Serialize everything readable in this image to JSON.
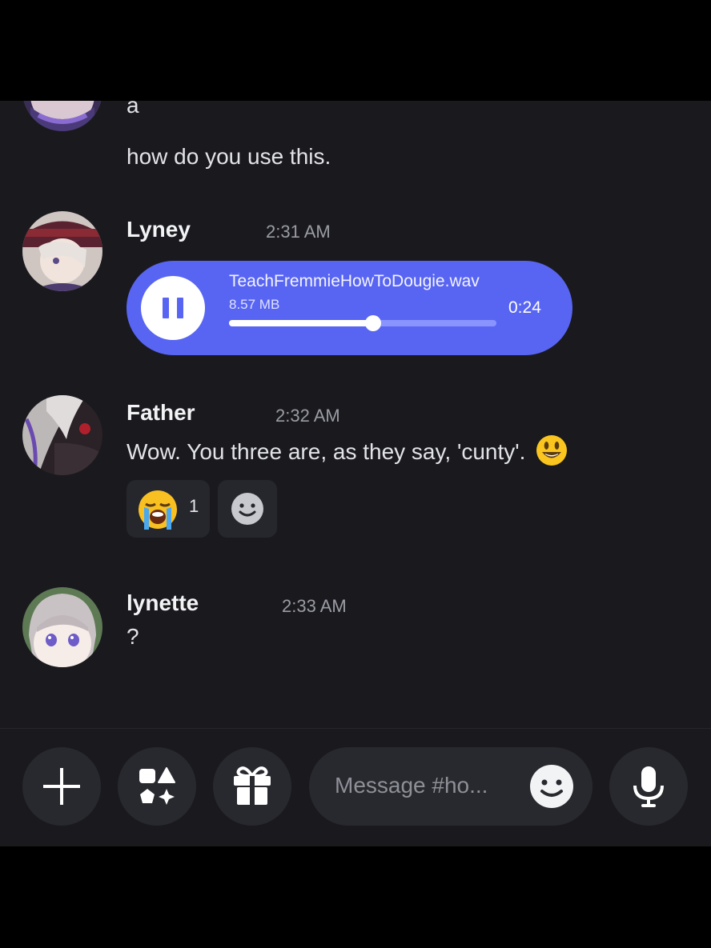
{
  "messages": [
    {
      "text": "a"
    },
    {
      "text": "how do you use this."
    }
  ],
  "lyney": {
    "username": "Lyney",
    "time": "2:31 AM",
    "attachment": {
      "filename": "TeachFremmieHowToDougie.wav",
      "size": "8.57 MB",
      "duration": "0:24",
      "progress": 0.54,
      "state": "playing"
    }
  },
  "father": {
    "username": "Father",
    "time": "2:32 AM",
    "text": "Wow. You three are, as they say, 'cunty'.",
    "text_emoji": "smiley-face-emoji",
    "reactions": [
      {
        "emoji": "loudly-crying-face",
        "count": "1"
      },
      {
        "emoji": "add-reaction-icon"
      }
    ]
  },
  "lynette": {
    "username": "lynette",
    "time": "2:33 AM",
    "text": "?"
  },
  "composer": {
    "placeholder": "Message #ho...",
    "buttons": [
      "plus-icon",
      "apps-icon",
      "gift-icon",
      "emoji-icon",
      "microphone-icon"
    ]
  },
  "colors": {
    "background": "#1a1a1e",
    "accent": "#5865f2",
    "username": "#f2f3f5",
    "timestamp": "#9a9ca4"
  }
}
